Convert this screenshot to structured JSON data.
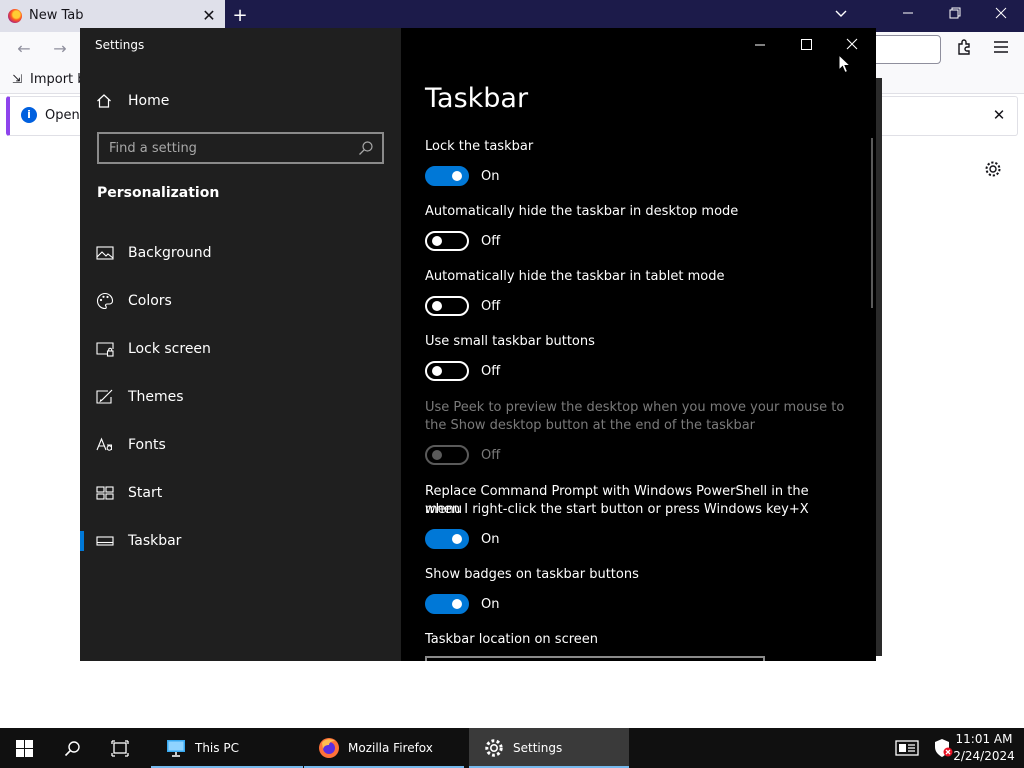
{
  "browser": {
    "tab_title": "New Tab",
    "import_label": "Import bo",
    "notice_text": "Open p"
  },
  "settings_window": {
    "title": "Settings",
    "home_label": "Home",
    "search_placeholder": "Find a setting",
    "section_title": "Personalization",
    "nav_items": [
      {
        "label": "Background",
        "icon": "image-icon"
      },
      {
        "label": "Colors",
        "icon": "palette-icon"
      },
      {
        "label": "Lock screen",
        "icon": "lock-screen-icon"
      },
      {
        "label": "Themes",
        "icon": "themes-brush-icon"
      },
      {
        "label": "Fonts",
        "icon": "fonts-icon"
      },
      {
        "label": "Start",
        "icon": "start-tiles-icon"
      },
      {
        "label": "Taskbar",
        "icon": "taskbar-icon",
        "selected": true
      }
    ],
    "page_title": "Taskbar",
    "settings": [
      {
        "label": "Lock the taskbar",
        "state": "On",
        "on": true
      },
      {
        "label": "Automatically hide the taskbar in desktop mode",
        "state": "Off",
        "on": false
      },
      {
        "label": "Automatically hide the taskbar in tablet mode",
        "state": "Off",
        "on": false
      },
      {
        "label": "Use small taskbar buttons",
        "state": "Off",
        "on": false
      },
      {
        "label_line1": "Use Peek to preview the desktop when you move your mouse to",
        "label_line2": "the Show desktop button at the end of the taskbar",
        "state": "Off",
        "on": false,
        "disabled": true
      },
      {
        "label_line1": "Replace Command Prompt with Windows PowerShell in the menu",
        "label_line2": "when I right-click the start button or press Windows key+X",
        "state": "On",
        "on": true
      },
      {
        "label": "Show badges on taskbar buttons",
        "state": "On",
        "on": true
      }
    ],
    "location_label": "Taskbar location on screen"
  },
  "taskbar": {
    "apps": [
      {
        "label": "This PC",
        "icon": "this-pc-icon"
      },
      {
        "label": "Mozilla Firefox",
        "icon": "firefox-icon"
      },
      {
        "label": "Settings",
        "icon": "settings-gear-icon",
        "active": true
      }
    ],
    "time": "11:01 AM",
    "date": "2/24/2024"
  },
  "colors": {
    "accent": "#0078d7",
    "nav_bg": "#1f1f1f",
    "content_bg": "#000000",
    "taskbar_bg": "#101010"
  }
}
